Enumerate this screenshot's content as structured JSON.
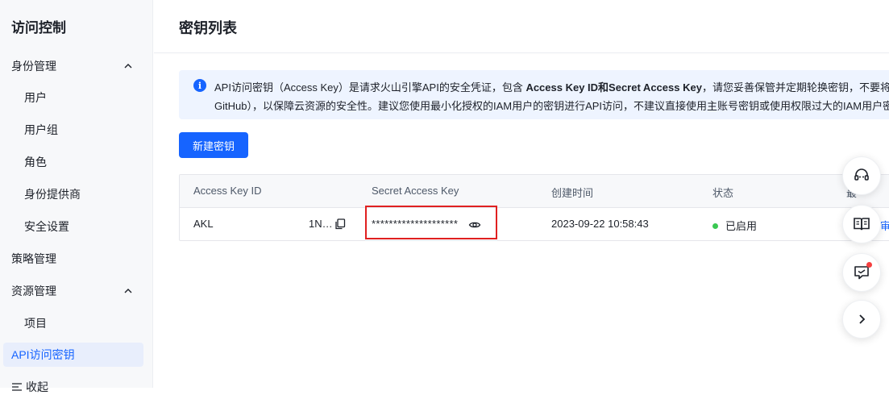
{
  "sidebar": {
    "title": "访问控制",
    "groups": [
      {
        "label": "身份管理",
        "items": [
          {
            "label": "用户"
          },
          {
            "label": "用户组"
          },
          {
            "label": "角色"
          },
          {
            "label": "身份提供商"
          },
          {
            "label": "安全设置"
          }
        ]
      },
      {
        "label": "策略管理"
      },
      {
        "label": "资源管理",
        "items": [
          {
            "label": "项目"
          },
          {
            "label": "API访问密钥"
          }
        ]
      }
    ],
    "partial_item": "收起"
  },
  "main": {
    "title": "密钥列表",
    "info": {
      "line1_a": "API访问密钥（Access Key）是请求火山引擎API的安全凭证，包含 ",
      "line1_b": "Access Key ID和Secret Access Key",
      "line1_c": "，请您妥善保管并定期轮换密钥，不要将密钥",
      "line2": "GitHub），以保障云资源的安全性。建议您使用最小化授权的IAM用户的密钥进行API访问，不建议直接使用主账号密钥或使用权限过大的IAM用户密"
    },
    "create_button": "新建密钥",
    "table": {
      "headers": [
        "Access Key ID",
        "Secret Access Key",
        "创建时间",
        "状态",
        "最"
      ],
      "rows": [
        {
          "access_key_id": "AKL",
          "access_key_id_tail": "1N…",
          "secret": "********************",
          "created": "2023-09-22 10:58:43",
          "status": "已启用",
          "action_partial": "审"
        }
      ]
    }
  },
  "colors": {
    "accent": "#1664ff",
    "status_enabled": "#3ac852",
    "highlight": "#e02020"
  },
  "floating_icons": [
    "headset-icon",
    "book-icon",
    "feedback-icon",
    "chevron-right-icon"
  ]
}
